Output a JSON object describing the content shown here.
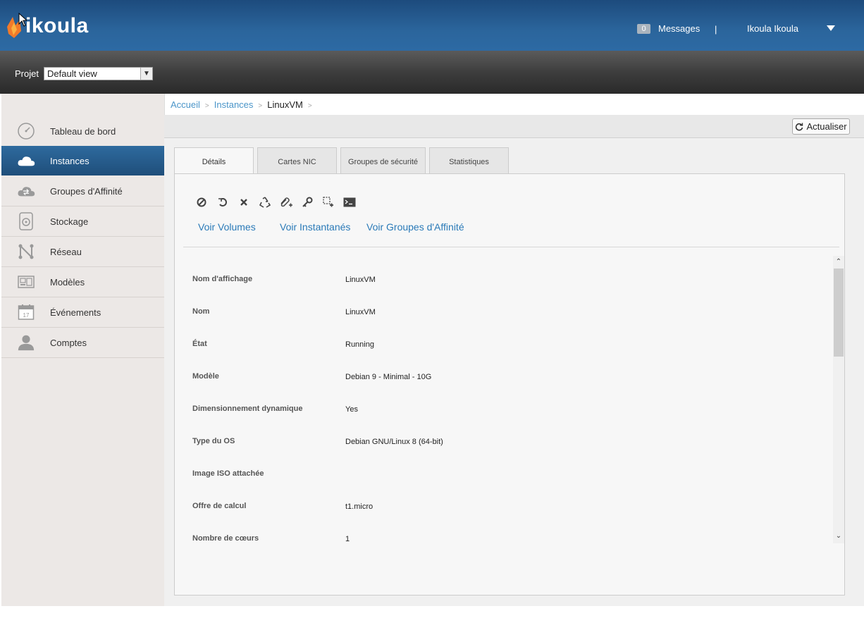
{
  "header": {
    "logo_text": "ikoula",
    "messages_count": "0",
    "messages_label": "Messages",
    "separator": "|",
    "user_name": "Ikoula Ikoula",
    "brand_colors": {
      "header_blue": "#2b659c",
      "logo_orange": "#f27a2a"
    }
  },
  "project": {
    "label": "Projet",
    "selected": "Default view"
  },
  "sidebar": {
    "items": [
      {
        "label": "Tableau de bord",
        "icon": "dashboard-gauge-icon"
      },
      {
        "label": "Instances",
        "icon": "cloud-icon",
        "active": true
      },
      {
        "label": "Groupes d'Affinité",
        "icon": "cloud-sync-icon"
      },
      {
        "label": "Stockage",
        "icon": "disk-icon"
      },
      {
        "label": "Réseau",
        "icon": "network-icon"
      },
      {
        "label": "Modèles",
        "icon": "templates-icon"
      },
      {
        "label": "Événements",
        "icon": "calendar-icon",
        "icon_text": "17"
      },
      {
        "label": "Comptes",
        "icon": "user-icon"
      }
    ]
  },
  "breadcrumb": {
    "home": "Accueil",
    "section": "Instances",
    "current": "LinuxVM",
    "sep": ">"
  },
  "toolbar": {
    "refresh_label": "Actualiser"
  },
  "tabs": [
    "Détails",
    "Cartes NIC",
    "Groupes de sécurité",
    "Statistiques"
  ],
  "actions": {
    "icons": [
      "stop-icon",
      "reboot-icon",
      "destroy-icon",
      "recycle-icon",
      "attach-iso-icon",
      "reset-password-icon",
      "scale-icon",
      "console-icon"
    ]
  },
  "links": {
    "volumes": "Voir Volumes",
    "snapshots": "Voir Instantanés",
    "affinity": "Voir Groupes d'Affinité"
  },
  "details": [
    {
      "label": "Nom d'affichage",
      "value": "LinuxVM"
    },
    {
      "label": "Nom",
      "value": "LinuxVM"
    },
    {
      "label": "État",
      "value": "Running"
    },
    {
      "label": "Modèle",
      "value": "Debian 9 - Minimal - 10G"
    },
    {
      "label": "Dimensionnement dynamique",
      "value": "Yes"
    },
    {
      "label": "Type du OS",
      "value": "Debian GNU/Linux 8 (64-bit)"
    },
    {
      "label": "Image ISO attachée",
      "value": ""
    },
    {
      "label": "Offre de calcul",
      "value": "t1.micro"
    },
    {
      "label": "Nombre de cœurs",
      "value": "1"
    }
  ]
}
